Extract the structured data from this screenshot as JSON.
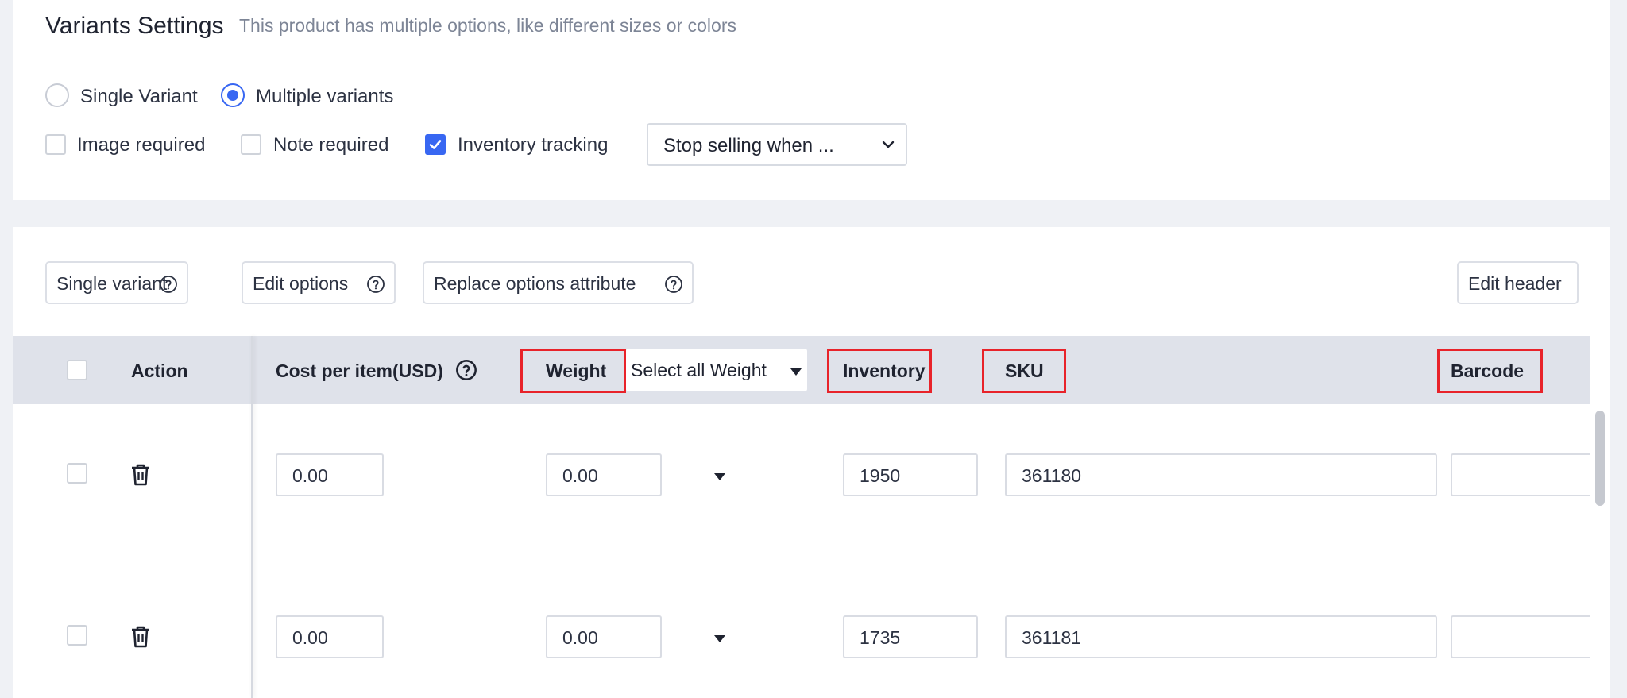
{
  "settings": {
    "title": "Variants Settings",
    "subtitle": "This product has multiple options, like different sizes or colors",
    "variant_mode": {
      "options": [
        "Single Variant",
        "Multiple variants"
      ],
      "selected": "Multiple variants"
    },
    "checkboxes": [
      {
        "label": "Image required",
        "checked": false
      },
      {
        "label": "Note required",
        "checked": false
      },
      {
        "label": "Inventory tracking",
        "checked": true
      }
    ],
    "inventory_policy": "Stop selling when ..."
  },
  "toolbar": {
    "single_variant": "Single variant",
    "edit_options": "Edit options",
    "replace_options": "Replace options attribute",
    "edit_header": "Edit header"
  },
  "table": {
    "headers": {
      "action": "Action",
      "cost": "Cost per item(USD)",
      "weight": "Weight",
      "weight_select": "Select all Weight",
      "inventory": "Inventory",
      "sku": "SKU",
      "barcode": "Barcode"
    },
    "rows": [
      {
        "cost": "0.00",
        "weight": "0.00",
        "inventory": "1950",
        "sku": "361180",
        "barcode": ""
      },
      {
        "cost": "0.00",
        "weight": "0.00",
        "inventory": "1735",
        "sku": "361181",
        "barcode": ""
      }
    ]
  },
  "colors": {
    "accent": "#3867f2",
    "highlight_box": "#e8232a",
    "header_bg": "#dfe2ea"
  },
  "icons": [
    "help-circle-icon",
    "trash-icon",
    "chevron-down-icon",
    "caret-down-icon",
    "checkmark-icon"
  ]
}
